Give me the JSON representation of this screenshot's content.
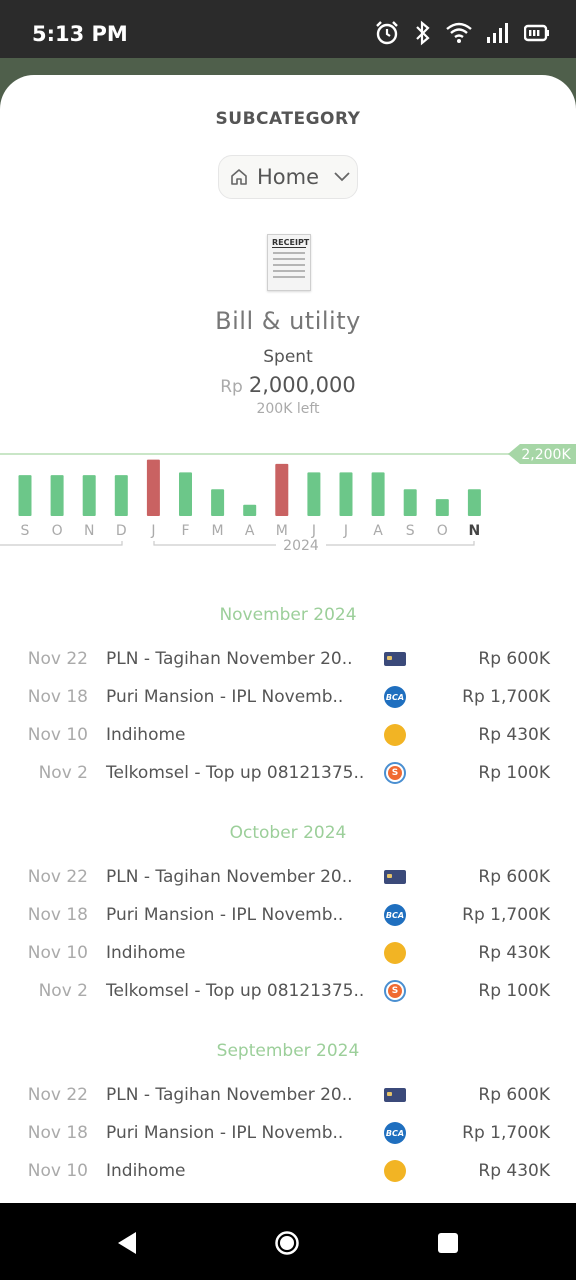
{
  "status": {
    "time": "5:13 PM"
  },
  "header": {
    "section_title": "SUBCATEGORY",
    "dropdown_label": "Home",
    "category_name": "Bill & utility",
    "spent_label": "Spent",
    "currency": "Rp",
    "spent_amount": "2,000,000",
    "left_label": "200K left"
  },
  "chart_data": {
    "type": "bar",
    "categories": [
      "S",
      "O",
      "N",
      "D",
      "J",
      "F",
      "M",
      "A",
      "M",
      "J",
      "J",
      "A",
      "S",
      "O",
      "N"
    ],
    "values": [
      1450,
      1450,
      1450,
      1450,
      2000,
      1550,
      950,
      400,
      1850,
      1550,
      1550,
      1550,
      950,
      600,
      950
    ],
    "over_budget": [
      false,
      false,
      false,
      false,
      true,
      false,
      false,
      false,
      true,
      false,
      false,
      false,
      false,
      false,
      false
    ],
    "budget_line": 2200,
    "budget_label": "2,200K",
    "year_label": "2024",
    "colors": {
      "normal": "#6cc789",
      "over": "#c96262",
      "line": "#c9e6c7",
      "tag": "#a6d6a6"
    }
  },
  "transactions": [
    {
      "month": "November 2024",
      "items": [
        {
          "date": "Nov 22",
          "name": "PLN - Tagihan November 20..",
          "icon": "card-icon",
          "amount": "Rp 600K"
        },
        {
          "date": "Nov 18",
          "name": "Puri Mansion - IPL Novemb..",
          "icon": "bca-icon",
          "amount": "Rp 1,700K"
        },
        {
          "date": "Nov 10",
          "name": "Indihome",
          "icon": "ovo-icon",
          "amount": "Rp 430K"
        },
        {
          "date": "Nov 2",
          "name": "Telkomsel - Top up 08121375..",
          "icon": "shopeepay-icon",
          "amount": "Rp 100K"
        }
      ]
    },
    {
      "month": "October 2024",
      "items": [
        {
          "date": "Nov 22",
          "name": "PLN - Tagihan November 20..",
          "icon": "card-icon",
          "amount": "Rp 600K"
        },
        {
          "date": "Nov 18",
          "name": "Puri Mansion - IPL Novemb..",
          "icon": "bca-icon",
          "amount": "Rp 1,700K"
        },
        {
          "date": "Nov 10",
          "name": "Indihome",
          "icon": "ovo-icon",
          "amount": "Rp 430K"
        },
        {
          "date": "Nov 2",
          "name": "Telkomsel - Top up 08121375..",
          "icon": "shopeepay-icon",
          "amount": "Rp 100K"
        }
      ]
    },
    {
      "month": "September 2024",
      "items": [
        {
          "date": "Nov 22",
          "name": "PLN - Tagihan November 20..",
          "icon": "card-icon",
          "amount": "Rp 600K"
        },
        {
          "date": "Nov 18",
          "name": "Puri Mansion - IPL Novemb..",
          "icon": "bca-icon",
          "amount": "Rp 1,700K"
        },
        {
          "date": "Nov 10",
          "name": "Indihome",
          "icon": "ovo-icon",
          "amount": "Rp 430K"
        }
      ]
    }
  ],
  "icon_labels": {
    "bca": "BCA",
    "shopeepay": "S"
  }
}
